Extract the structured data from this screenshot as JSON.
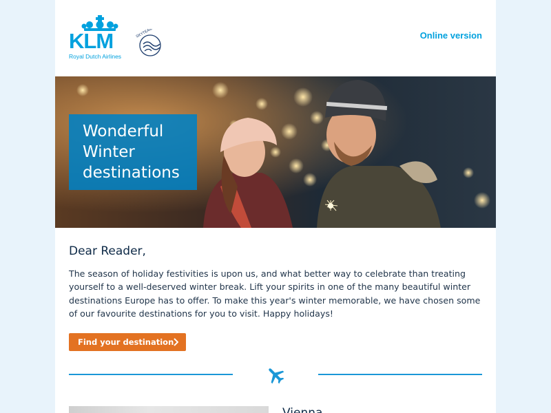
{
  "header": {
    "logo_word": "KLM",
    "logo_sub": "Royal Dutch Airlines",
    "alliance": "SKYTEAM",
    "online_link": "Online version"
  },
  "hero": {
    "title_lines": [
      "Wonderful",
      "Winter",
      "destinations"
    ]
  },
  "content": {
    "greeting": "Dear Reader,",
    "intro": "The season of holiday festivities is upon us, and what better way to celebrate than treating yourself to a well-deserved winter break. Lift your spirits in one of the many beautiful winter destinations Europe has to offer. To make this year's winter memorable, we have chosen some of our favourite destinations for you to visit. Happy holidays!",
    "cta_label": "Find your destination"
  },
  "next": {
    "destination": "Vienna"
  },
  "colors": {
    "brand_blue": "#00a1de",
    "cta_orange": "#e37222",
    "page_bg": "#e8f3fb"
  },
  "icons": [
    "klm-crown-icon",
    "skyteam-icon",
    "chevron-right-icon",
    "airplane-icon"
  ]
}
